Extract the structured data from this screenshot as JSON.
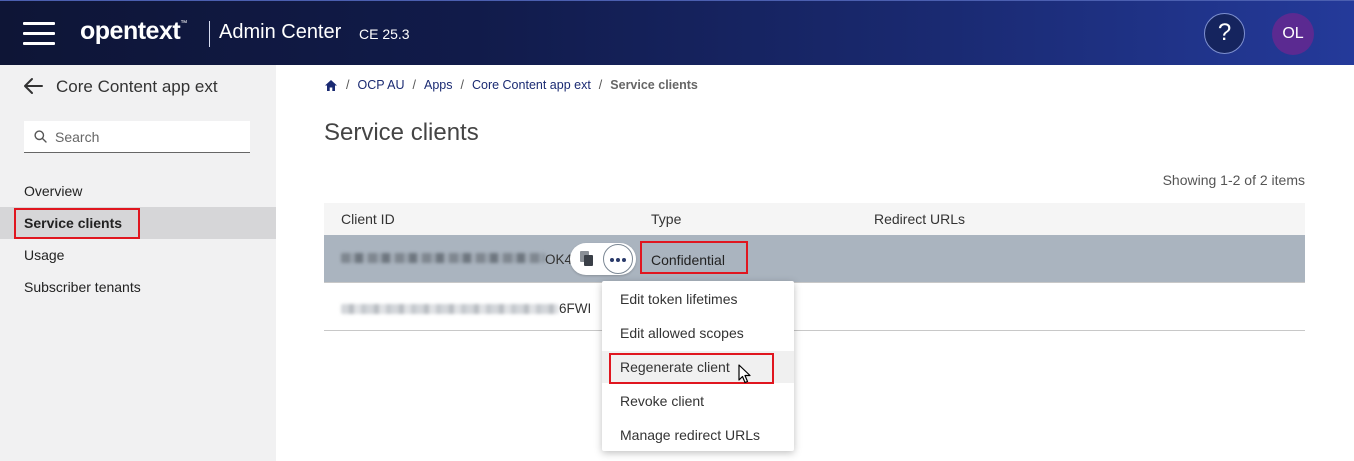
{
  "header": {
    "brand": "opentext",
    "brand_tm": "™",
    "app_name": "Admin Center",
    "version": "CE 25.3",
    "help_label": "?",
    "avatar_initials": "OL",
    "colors": {
      "header_start": "#0e1536",
      "header_end": "#243a9a",
      "avatar_bg": "#5b2a91"
    }
  },
  "sidebar": {
    "title": "Core Content app ext",
    "search_placeholder": "Search",
    "items": [
      {
        "label": "Overview"
      },
      {
        "label": "Service clients",
        "active": true
      },
      {
        "label": "Usage"
      },
      {
        "label": "Subscriber tenants"
      }
    ]
  },
  "breadcrumb": {
    "items": [
      "OCP AU",
      "Apps",
      "Core Content app ext"
    ],
    "current": "Service clients",
    "separator": "/"
  },
  "page": {
    "title": "Service clients",
    "showing": "Showing 1-2 of 2 items"
  },
  "table": {
    "columns": [
      "Client ID",
      "Type",
      "Redirect URLs"
    ],
    "rows": [
      {
        "client_id_visible": "OK4",
        "type": "Confidential",
        "redirect_urls": ""
      },
      {
        "client_id_visible": "6FWI",
        "type": "",
        "redirect_urls": ""
      }
    ]
  },
  "context_menu": {
    "items": [
      {
        "label": "Edit token lifetimes"
      },
      {
        "label": "Edit allowed scopes"
      },
      {
        "label": "Regenerate client",
        "highlighted": true
      },
      {
        "label": "Revoke client"
      },
      {
        "label": "Manage redirect URLs"
      }
    ]
  },
  "highlight_color": "#e0161f"
}
